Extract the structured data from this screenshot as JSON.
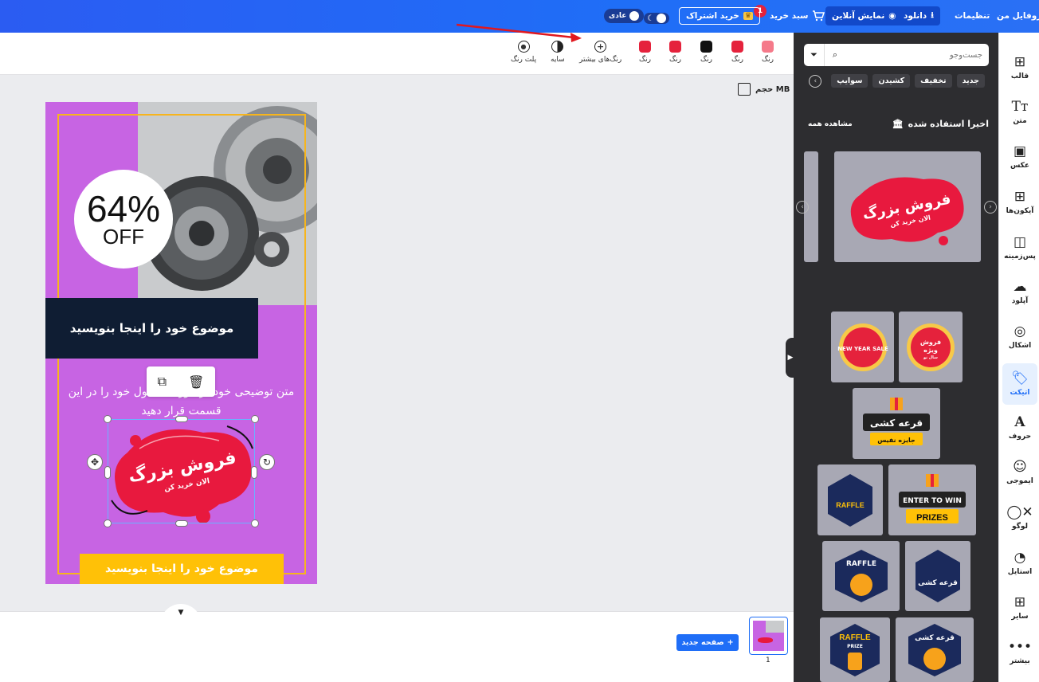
{
  "topbar": {
    "profile": "پروفایل من",
    "settings": "تنظیمات",
    "download": "دانلود",
    "preview": "نمایش آنلاین",
    "cart": "سبد خرید",
    "cart_count": "1",
    "subscribe": "خرید اشتراک",
    "mode": "عادی"
  },
  "toolbar": {
    "tools": [
      {
        "label": "رنگ",
        "color": "#f57a8a"
      },
      {
        "label": "رنگ",
        "color": "#e5223c"
      },
      {
        "label": "رنگ",
        "color": "#111111"
      },
      {
        "label": "رنگ",
        "color": "#e5223c"
      },
      {
        "label": "رنگ",
        "color": "#e5223c"
      },
      {
        "label": "رنگ‌های بیشتر",
        "icon": "plus-circle-icon"
      },
      {
        "label": "سایه",
        "icon": "shade-icon"
      },
      {
        "label": "پلت رنگ",
        "icon": "palette-icon"
      }
    ],
    "size_label": "حجم MB"
  },
  "design": {
    "discount_value": "64%",
    "discount_off": "OFF",
    "title": "موضوع خود را اینجا بنویسید",
    "body_text": "متن توضیحی خود در مورد محصول خود را در این قسمت قرار دهید",
    "footer_title": "موضوع خود را اینجا بنویسید",
    "sticker_main": "فروش بزرگ",
    "sticker_sub": "الان خرید کن"
  },
  "pages": {
    "new_page": "صفحه جدید",
    "page_number": "1"
  },
  "panel": {
    "search_placeholder": "جست‌وجو",
    "chips": [
      "جدید",
      "تخفیف",
      "کشیدن",
      "سوایپ"
    ],
    "recent_title": "اخیرا استفاده شده",
    "see_all": "مشاهده همه",
    "featured_main": "فروش بزرگ",
    "featured_sub": "الان خرید کن",
    "stickers": {
      "s1_line1": "فروش",
      "s1_line2": "ویژه",
      "s1_line3": "سال نو",
      "s2": "NEW YEAR SALE",
      "s3_main": "قرعه کشی",
      "s3_sub": "جایزه نفیس",
      "s4_main": "ENTER TO WIN",
      "s4_sub": "PRIZES",
      "s5": "RAFFLE",
      "s6": "قرعه کشی",
      "s7": "RAFFLE",
      "s8": "RAFFLE",
      "s8_sub": "PRIZE",
      "s9": "قرعه کشی"
    }
  },
  "sidebar": {
    "items": [
      {
        "label": "قالب"
      },
      {
        "label": "متن"
      },
      {
        "label": "عکس"
      },
      {
        "label": "آیکون‌ها"
      },
      {
        "label": "پس‌زمینه"
      },
      {
        "label": "آپلود"
      },
      {
        "label": "اشکال"
      },
      {
        "label": "اتیکت"
      },
      {
        "label": "حروف"
      },
      {
        "label": "ایموجی"
      },
      {
        "label": "لوگو"
      },
      {
        "label": "استایل"
      },
      {
        "label": "سایر"
      },
      {
        "label": "بیشتر"
      }
    ]
  },
  "colors": {
    "brand_blue": "#1f6ef7",
    "panel_bg": "#2d2d30",
    "design_purple": "#c764e3",
    "accent_red": "#e5223c",
    "accent_yellow": "#ffc107"
  }
}
